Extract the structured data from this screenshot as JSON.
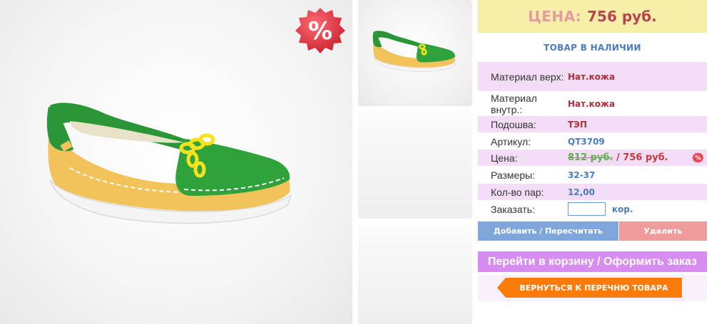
{
  "badges": {
    "sale_symbol": "%",
    "color": "#e8414e"
  },
  "price_header": {
    "label": "ЦЕНА:",
    "value": "756 руб."
  },
  "stock_status": "ТОВАР В НАЛИЧИИ",
  "specs": [
    {
      "key": "Материал верх:",
      "value": "Нат.кожа"
    },
    {
      "key": "Материал внутр.:",
      "value": "Нат.кожа"
    },
    {
      "key": "Подошва:",
      "value": "ТЭП"
    },
    {
      "key": "Артикул:",
      "value": "QT3709"
    },
    {
      "key": "Цена:",
      "old_value": "812 руб.",
      "separator": " / ",
      "value": "756 руб."
    },
    {
      "key": "Размеры:",
      "value": "32-37"
    },
    {
      "key": "Кол-во пар:",
      "value": "12,00"
    },
    {
      "key": "Заказать:",
      "input_value": "",
      "unit": "кор."
    }
  ],
  "buttons": {
    "add": "Добавить / Пересчитать",
    "delete": "Удалить",
    "cart": "Перейти в корзину / Оформить заказ",
    "back": "ВЕРНУТЬСЯ К ПЕРЕЧНЮ ТОВАРА"
  },
  "colors": {
    "price_bg": "#f7efa8",
    "row_pink": "#f3ddf6",
    "add_button": "#7fa6db",
    "delete_button": "#ee9b9b",
    "cart_button": "#d78cf0",
    "back_button": "#fb7b0a"
  }
}
